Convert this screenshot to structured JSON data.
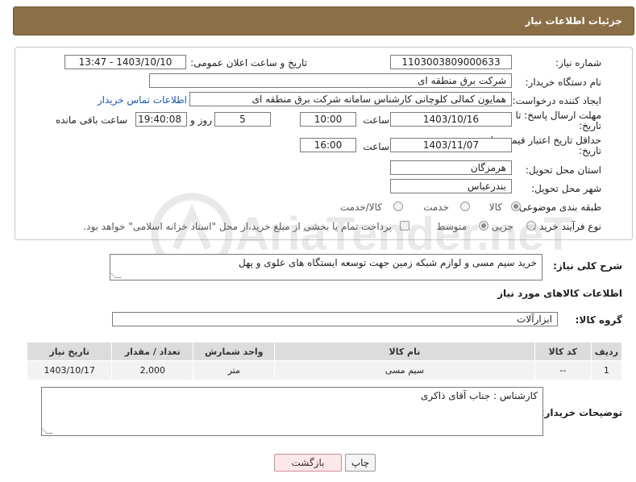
{
  "header": {
    "title": "جزئیات اطلاعات نیاز"
  },
  "form": {
    "need_number": {
      "label": "شماره نیاز:",
      "value": "1103003809000633"
    },
    "announce_datetime": {
      "label": "تاریخ و ساعت اعلان عمومی:",
      "value": "1403/10/10 - 13:47"
    },
    "buyer_org": {
      "label": "نام دستگاه خریدار:",
      "value": "شرکت برق منطقه ای"
    },
    "creator": {
      "label": "ایجاد کننده درخواست:",
      "value": "همایون کمالی کلوچانی کارشناس سامانه شرکت برق منطقه ای",
      "contact_link": "اطلاعات تماس خریدار"
    },
    "reply_deadline": {
      "label_line1": "مهلت ارسال پاسخ: تا",
      "label_line2": "تاریخ:",
      "date": "1403/10/16",
      "time_label": "ساعت",
      "time": "10:00",
      "days": "5",
      "days_label": "روز و",
      "remaining": "19:40:08",
      "remaining_label": "ساعت باقی مانده"
    },
    "price_deadline": {
      "label_line1": "حداقل تاریخ اعتبار قیمت: تا",
      "label_line2": "تاریخ:",
      "date": "1403/11/07",
      "time_label": "ساعت",
      "time": "16:00"
    },
    "province": {
      "label": "استان محل تحویل:",
      "value": "هرمزگان"
    },
    "city": {
      "label": "شهر محل تحویل:",
      "value": "بندرعباس"
    },
    "category": {
      "label": "طبقه بندی موضوعی:",
      "options": [
        "کالا",
        "خدمت",
        "کالا/خدمت"
      ],
      "selected": "کالا"
    },
    "purchase_type": {
      "label": "نوع فرآیند خرید :",
      "options": [
        "جزیی",
        "متوسط"
      ],
      "selected": "متوسط",
      "payment_note": "پرداخت تمام یا بخشی از مبلغ خرید،از محل \"اسناد خزانه اسلامی\" خواهد بود."
    }
  },
  "description": {
    "label": "شرح کلی نیاز:",
    "value": "خرید سیم مسی و لوازم شبکه زمین جهت توسعه ایستگاه های علوی و پهل"
  },
  "goods_section": {
    "title": "اطلاعات کالاهای مورد نیاز"
  },
  "goods_group": {
    "label": "گروه کالا:",
    "value": "ابزارآلات"
  },
  "table": {
    "headers": [
      "ردیف",
      "کد کالا",
      "نام کالا",
      "واحد شمارش",
      "تعداد / مقدار",
      "تاریخ نیاز"
    ],
    "rows": [
      [
        "1",
        "--",
        "سیم مسی",
        "متر",
        "2,000",
        "1403/10/17"
      ]
    ]
  },
  "buyer_notes": {
    "label": "توضیحات خریدار:",
    "value": "کارشناس : جناب آقای ذاکری"
  },
  "buttons": {
    "print": "چاپ",
    "back": "بازگشت"
  },
  "watermark": {
    "text": "AriaTender.neT"
  },
  "colors": {
    "header_bg": "#8b6f47",
    "link": "#1a56b8",
    "back_button_bg": "#fce8ea"
  }
}
